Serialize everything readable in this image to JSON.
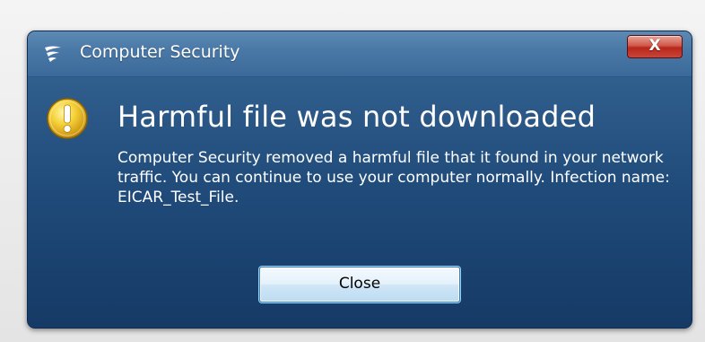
{
  "window": {
    "title": "Computer Security",
    "close_glyph": "X"
  },
  "alert": {
    "icon": "warning-exclamation-icon",
    "headline": "Harmful file was not downloaded",
    "message": "Computer Security removed a harmful file that it found in your network traffic. You can continue to use your computer normally. Infection name: EICAR_Test_File."
  },
  "actions": {
    "close_label": "Close"
  },
  "colors": {
    "window_blue": "#1f4a79",
    "titlebar_blue": "#4a79a7",
    "close_red": "#c8453a",
    "warning_yellow": "#f2c21a",
    "button_face": "#e4f1fa"
  }
}
